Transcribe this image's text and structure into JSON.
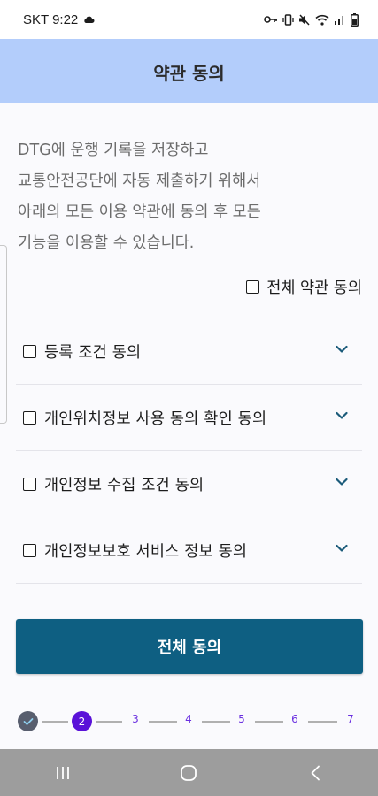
{
  "status_bar": {
    "carrier_time": "SKT 9:22",
    "icons": [
      "cloud-icon",
      "key-icon",
      "vibrate-icon",
      "mute-icon",
      "wifi-icon",
      "signal-icon",
      "battery-icon"
    ]
  },
  "header": {
    "title": "약관 동의"
  },
  "intro": {
    "lines": [
      "DTG에 운행 기록을 저장하고",
      "교통안전공단에 자동 제출하기 위해서",
      "아래의 모든 이용 약관에 동의 후 모든",
      "기능을 이용할 수 있습니다."
    ]
  },
  "all_terms_checkbox": {
    "label": "전체 약관 동의",
    "checked": false
  },
  "terms": [
    {
      "label": "등록 조건 동의",
      "checked": false
    },
    {
      "label": "개인위치정보 사용 동의 확인 동의",
      "checked": false
    },
    {
      "label": "개인정보 수집 조건 동의",
      "checked": false
    },
    {
      "label": "개인정보보호 서비스 정보 동의",
      "checked": false
    }
  ],
  "agree_all_button": {
    "label": "전체 동의"
  },
  "stepper": {
    "current_step": "2",
    "steps": [
      "3",
      "4",
      "5",
      "6",
      "7"
    ]
  },
  "colors": {
    "app_bar": "#b3cdfb",
    "primary_button": "#0e5f82",
    "chevron": "#1b5b7a",
    "step_current": "#5a12d8",
    "step_done": "#585e6e"
  },
  "nav_bar": {
    "icons": [
      "recent-apps-icon",
      "home-icon",
      "back-icon"
    ]
  }
}
